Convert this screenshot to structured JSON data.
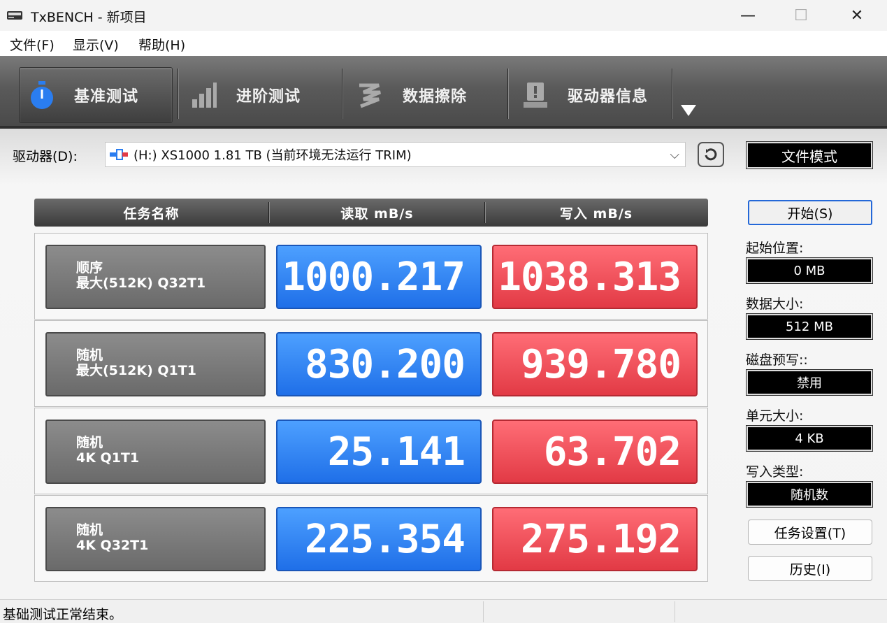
{
  "window": {
    "title": "TxBENCH - 新项目",
    "minimize_glyph": "—",
    "maximize_glyph": "☐",
    "close_glyph": "✕"
  },
  "menu": [
    "文件(F)",
    "显示(V)",
    "帮助(H)"
  ],
  "tabs": [
    {
      "label": "基准测试",
      "icon": "stopwatch-icon",
      "active": true
    },
    {
      "label": "进阶测试",
      "icon": "bar-chart-icon",
      "active": false
    },
    {
      "label": "数据擦除",
      "icon": "eraser-icon",
      "active": false
    },
    {
      "label": "驱动器信息",
      "icon": "drive-info-icon",
      "active": false
    }
  ],
  "drive": {
    "label": "驱动器(D):",
    "selected": "(H:) XS1000  1.81 TB (当前环境无法运行 TRIM)"
  },
  "file_mode_label": "文件模式",
  "results": {
    "headers": {
      "task": "任务名称",
      "read": "读取 mB/s",
      "write": "写入 mB/s"
    },
    "rows": [
      {
        "line1": "顺序",
        "line2": "最大(512K) Q32T1",
        "read": "1000.217",
        "write": "1038.313"
      },
      {
        "line1": "随机",
        "line2": "最大(512K) Q1T1",
        "read": "830.200",
        "write": "939.780"
      },
      {
        "line1": "随机",
        "line2": "4K Q1T1",
        "read": "25.141",
        "write": "63.702"
      },
      {
        "line1": "随机",
        "line2": "4K Q32T1",
        "read": "225.354",
        "write": "275.192"
      }
    ]
  },
  "side": {
    "start_button": "开始(S)",
    "settings": [
      {
        "label": "起始位置:",
        "value": "0 MB"
      },
      {
        "label": "数据大小:",
        "value": "512 MB"
      },
      {
        "label": "磁盘预写::",
        "value": "禁用"
      },
      {
        "label": "单元大小:",
        "value": "4 KB"
      },
      {
        "label": "写入类型:",
        "value": "随机数"
      }
    ],
    "task_settings_button": "任务设置(T)",
    "history_button": "历史(I)"
  },
  "status": "基础测试正常结束。",
  "colors": {
    "read_blue": "#2a7df0",
    "write_red": "#ec4a54",
    "toolbar_dark": "#4a4a4a"
  }
}
